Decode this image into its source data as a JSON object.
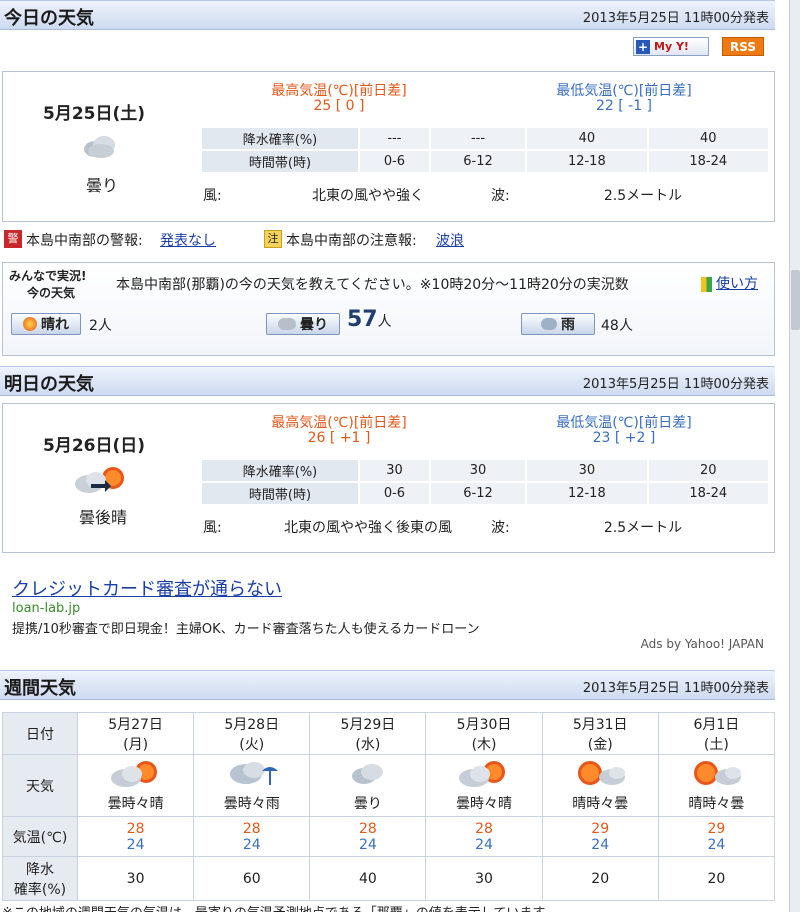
{
  "today": {
    "title": "今日の天気",
    "date": "2013年5月25日 11時00分発表",
    "my_yahoo_label": "My Y!",
    "rss_label": "RSS",
    "day_label": "5月25日(土)",
    "weather": "曇り",
    "max_header": "最高気温(℃)[前日差]",
    "max_value": "25 [ 0 ]",
    "min_header": "最低気温(℃)[前日差]",
    "min_value": "22 [ -1 ]",
    "precip_label": "降水確率(%)",
    "precip": [
      "---",
      "---",
      "40",
      "40"
    ],
    "time_label": "時間帯(時)",
    "times": [
      "0-6",
      "6-12",
      "12-18",
      "18-24"
    ],
    "wind_label": "風:",
    "wind": "北東の風やや強く",
    "wave_label": "波:",
    "wave": "2.5メートル"
  },
  "alerts": {
    "warn_icon": "警",
    "warn_text": "本島中南部の警報:",
    "warn_link": "発表なし",
    "adv_icon": "注",
    "adv_text": "本島中南部の注意報:",
    "adv_link": "波浪"
  },
  "minna": {
    "logo_line1": "みんなで実況!",
    "logo_line2": "今の天気",
    "prompt": "本島中南部(那覇)の今の天気を教えてください。※10時20分〜11時20分の実況数",
    "usage_link": "使い方",
    "sunny_label": "晴れ",
    "sunny_count": "2人",
    "cloudy_label": "曇り",
    "cloudy_count": "57",
    "cloudy_unit": "人",
    "rain_label": "雨",
    "rain_count": "48人"
  },
  "tomorrow": {
    "title": "明日の天気",
    "date": "2013年5月25日 11時00分発表",
    "day_label": "5月26日(日)",
    "weather": "曇後晴",
    "max_header": "最高気温(℃)[前日差]",
    "max_value": "26 [ +1 ]",
    "min_header": "最低気温(℃)[前日差]",
    "min_value": "23 [ +2 ]",
    "precip_label": "降水確率(%)",
    "precip": [
      "30",
      "30",
      "30",
      "20"
    ],
    "time_label": "時間帯(時)",
    "times": [
      "0-6",
      "6-12",
      "12-18",
      "18-24"
    ],
    "wind_label": "風:",
    "wind": "北東の風やや強く後東の風",
    "wave_label": "波:",
    "wave": "2.5メートル"
  },
  "ad": {
    "title": "クレジットカード審査が通らない",
    "domain": "loan-lab.jp",
    "desc": "提携/10秒審査で即日現金！主婦OK、カード審査落ちた人も使えるカードローン",
    "credit": "Ads by Yahoo! JAPAN"
  },
  "weekly": {
    "title": "週間天気",
    "date": "2013年5月25日 11時00分発表",
    "date_label": "日付",
    "weather_label": "天気",
    "temp_label": "気温(℃)",
    "precip_label_1": "降水",
    "precip_label_2": "確率(%)",
    "days": [
      {
        "date": "5月27日",
        "dow": "(月)",
        "weather": "曇時々晴",
        "icon": "cloud-sun-icon",
        "high": "28",
        "low": "24",
        "precip": "30"
      },
      {
        "date": "5月28日",
        "dow": "(火)",
        "weather": "曇時々雨",
        "icon": "cloud-rain-icon",
        "high": "28",
        "low": "24",
        "precip": "60"
      },
      {
        "date": "5月29日",
        "dow": "(水)",
        "weather": "曇り",
        "icon": "cloud-icon",
        "high": "28",
        "low": "24",
        "precip": "40"
      },
      {
        "date": "5月30日",
        "dow": "(木)",
        "weather": "曇時々晴",
        "icon": "cloud-sun-icon",
        "high": "28",
        "low": "24",
        "precip": "30"
      },
      {
        "date": "5月31日",
        "dow": "(金)",
        "weather": "晴時々曇",
        "icon": "sun-cloud-icon",
        "high": "29",
        "low": "24",
        "precip": "20"
      },
      {
        "date": "6月1日",
        "dow": "(土)",
        "weather": "晴時々曇",
        "icon": "sun-cloud-icon",
        "high": "29",
        "low": "24",
        "precip": "20"
      }
    ]
  },
  "footer_note": "※この地域の週間天気の気温は、最寄りの気温予測地点である「那覇」の値を表示しています。",
  "colors": {
    "high": "#e2591b",
    "low": "#3a6fc0",
    "header_bg": "#cddaf0"
  }
}
